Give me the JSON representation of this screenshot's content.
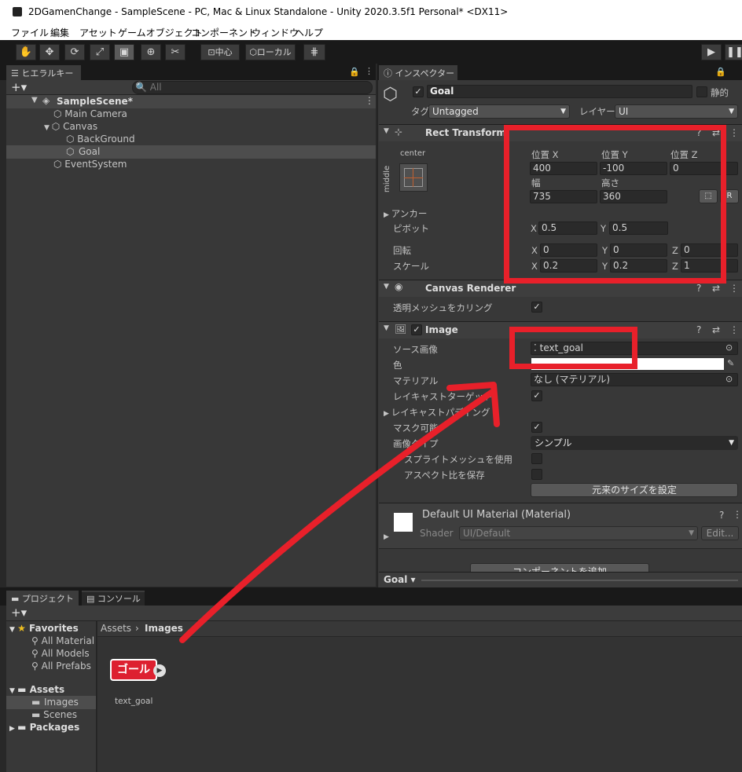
{
  "window": {
    "title": "2DGamenChange - SampleScene - PC, Mac & Linux Standalone - Unity 2020.3.5f1 Personal* <DX11>"
  },
  "menu": [
    "ファイル",
    "編集",
    "アセット",
    "ゲームオブジェクト",
    "コンポーネント",
    "ウィンドウ",
    "ヘルプ"
  ],
  "toolbar": {
    "pivot_label": "中心",
    "space_label": "ローカル"
  },
  "hierarchy": {
    "tab": "ヒエラルキー",
    "search_placeholder": "All",
    "items": [
      {
        "label": "SampleScene*",
        "depth": 0
      },
      {
        "label": "Main Camera",
        "depth": 1
      },
      {
        "label": "Canvas",
        "depth": 1
      },
      {
        "label": "BackGround",
        "depth": 2
      },
      {
        "label": "Goal",
        "depth": 2
      },
      {
        "label": "EventSystem",
        "depth": 1
      }
    ]
  },
  "inspector": {
    "tab": "インスペクター",
    "name": "Goal",
    "static_label": "静的",
    "tag_label": "タグ",
    "tag_value": "Untagged",
    "layer_label": "レイヤー",
    "layer_value": "UI",
    "rect": {
      "title": "Rect Transform",
      "anchor_h": "center",
      "anchor_v": "middle",
      "posx_label": "位置 X",
      "posy_label": "位置 Y",
      "posz_label": "位置 Z",
      "posx": "400",
      "posy": "-100",
      "posz": "0",
      "w_label": "幅",
      "h_label": "高さ",
      "w": "735",
      "h": "360",
      "anchor_label": "アンカー",
      "pivot_label": "ピボット",
      "pivot_x": "0.5",
      "pivot_y": "0.5",
      "rot_label": "回転",
      "rot_x": "0",
      "rot_y": "0",
      "rot_z": "0",
      "scale_label": "スケール",
      "scale_x": "0.2",
      "scale_y": "0.2",
      "scale_z": "1",
      "x": "X",
      "y": "Y",
      "z": "Z"
    },
    "canvas_renderer": {
      "title": "Canvas Renderer",
      "cull_label": "透明メッシュをカリング"
    },
    "image": {
      "title": "Image",
      "source_label": "ソース画像",
      "source_value": "text_goal",
      "color_label": "色",
      "material_label": "マテリアル",
      "material_value": "なし (マテリアル)",
      "raycast_label": "レイキャストターゲット",
      "raycast_padding_label": "レイキャストパディング",
      "maskable_label": "マスク可能",
      "image_type_label": "画像タイプ",
      "image_type_value": "シンプル",
      "sprite_mesh_label": "スプライトメッシュを使用",
      "preserve_aspect_label": "アスペクト比を保存",
      "native_size_button": "元来のサイズを設定"
    },
    "material": {
      "title": "Default UI Material (Material)",
      "shader_label": "Shader",
      "shader_value": "UI/Default",
      "edit_label": "Edit..."
    },
    "add_component": "コンポーネントを追加",
    "footer_label": "Goal"
  },
  "project": {
    "tab": "プロジェクト",
    "console_tab": "コンソール",
    "favorites_label": "Favorites",
    "favorites": [
      "All Material",
      "All Models",
      "All Prefabs"
    ],
    "assets_label": "Assets",
    "asset_folders": [
      "Images",
      "Scenes"
    ],
    "packages_label": "Packages",
    "breadcrumb": [
      "Assets",
      "Images"
    ],
    "asset_name": "text_goal",
    "thumb_text": "ゴール"
  },
  "colors": {
    "highlight": "#e8202a",
    "bg": "#282828",
    "panel": "#383838"
  }
}
